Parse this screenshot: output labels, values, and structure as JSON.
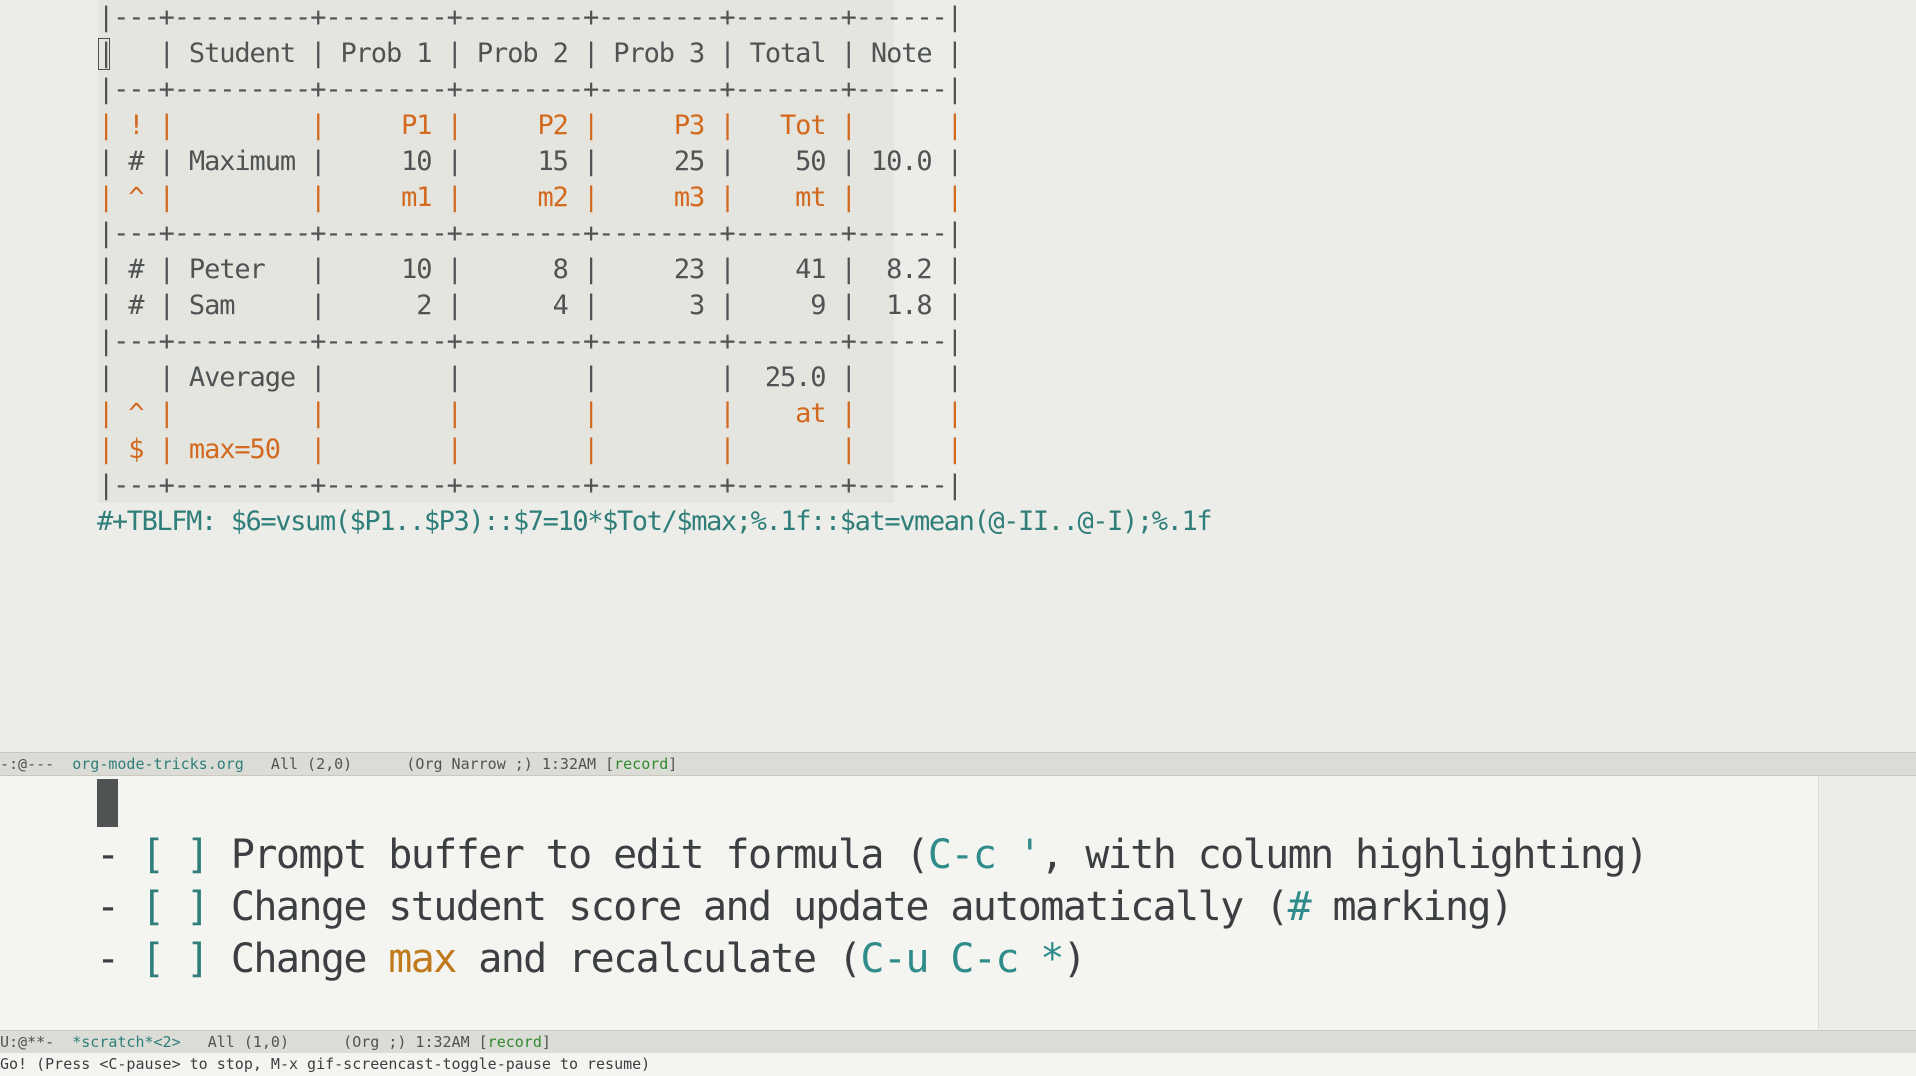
{
  "table": {
    "lines": {
      "sep": "|---+---------+--------+--------+--------+-------+------|",
      "header": "|   | Student | Prob 1 | Prob 2 | Prob 3 | Total | Note |",
      "names_row": "| ! |         |     P1 |     P2 |     P3 |   Tot |      |",
      "max_row": "| # | Maximum |     10 |     15 |     25 |    50 | 10.0 |",
      "params_row": "| ^ |         |     m1 |     m2 |     m3 |    mt |      |",
      "peter_row": "| # | Peter   |     10 |      8 |     23 |    41 |  8.2 |",
      "sam_row": "| # | Sam     |      2 |      4 |      3 |     9 |  1.8 |",
      "average_row": "|   | Average |        |        |        |  25.0 |      |",
      "at_row": "| ^ |         |        |        |        |    at |      |",
      "max_def_row": "| $ | max=50  |        |        |        |       |      |"
    }
  },
  "tblfm": "#+TBLFM: $6=vsum($P1..$P3)::$7=10*$Tot/$max;%.1f::$at=vmean(@-II..@-I);%.1f",
  "modeline_top": {
    "prefix": "-:@---  ",
    "buffer": "org-mode-tricks.org",
    "position": "   All (2,0)      (Org Narrow ;) 1:32AM [",
    "record": "record",
    "suffix": "]"
  },
  "checklist": [
    {
      "dash": "- ",
      "box": "[ ]",
      "text_a": " Prompt buffer to edit formula (",
      "key": "C-c '",
      "text_b": ", with column highlighting)"
    },
    {
      "dash": "- ",
      "box": "[ ]",
      "text_a": " Change student score and update automatically (",
      "key": "#",
      "text_b": " marking)"
    },
    {
      "dash": "- ",
      "box": "[ ]",
      "text_a": " Change ",
      "kw": "max",
      "text_mid": " and recalculate (",
      "key": "C-u C-c *",
      "text_b": ")"
    }
  ],
  "modeline_bottom": {
    "prefix": "U:@**-  ",
    "buffer": "*scratch*<2>",
    "position": "   All (1,0)      (Org ;) 1:32AM [",
    "record": "record",
    "suffix": "]"
  },
  "echo_area": "Go! (Press <C-pause> to stop, M-x gif-screencast-toggle-pause to resume)"
}
